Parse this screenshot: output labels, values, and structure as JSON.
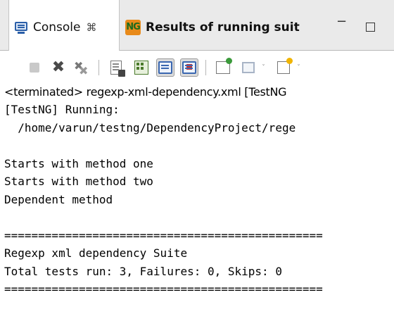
{
  "tabs": [
    {
      "label": "Console",
      "close": "⌘",
      "icon": "console-icon",
      "active": true
    },
    {
      "label": "Results of running suit",
      "icon": "testng-icon",
      "icon_text": "NG",
      "active": false
    }
  ],
  "window_controls": {
    "minimize": "−"
  },
  "toolbar": {
    "buttons": [
      "terminate-icon",
      "remove-launch-icon",
      "remove-all-terminated-icon",
      "clear-console-icon",
      "scroll-lock-icon",
      "show-when-stdout-icon",
      "show-when-stderr-icon",
      "pin-console-icon",
      "display-selected-console-icon",
      "open-console-icon"
    ],
    "caret": "ˇ"
  },
  "status_line": "<terminated> regexp-xml-dependency.xml [TestNG",
  "console_lines": [
    "[TestNG] Running:",
    "  /home/varun/testng/DependencyProject/rege",
    "",
    "Starts with method one",
    "Starts with method two",
    "Dependent method",
    "",
    "===============================================",
    "Regexp xml dependency Suite",
    "Total tests run: 3, Failures: 0, Skips: 0",
    "==============================================="
  ]
}
